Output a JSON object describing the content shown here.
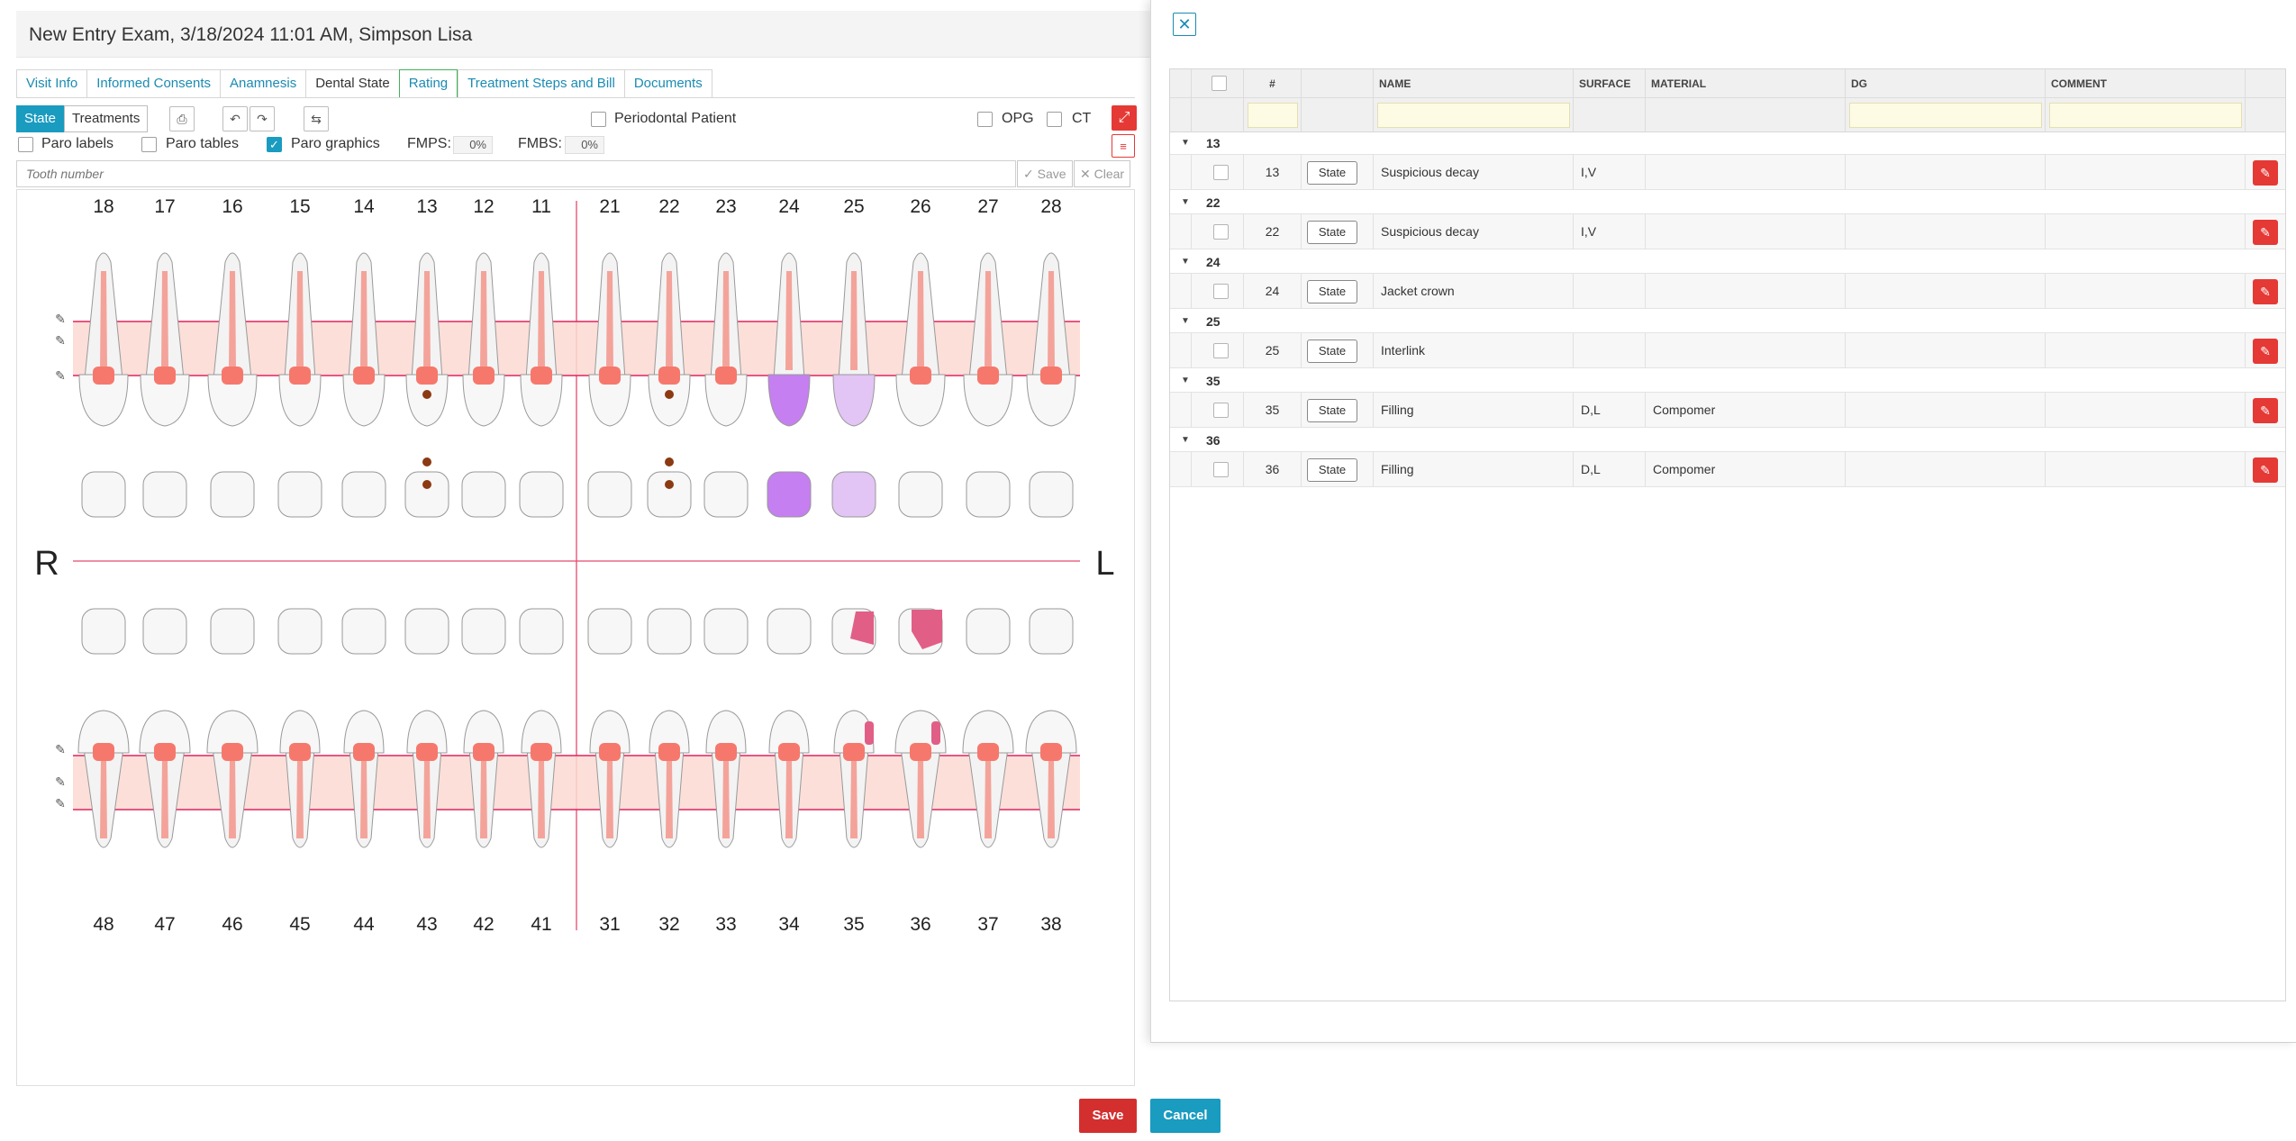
{
  "exam": {
    "title": "New Entry Exam, 3/18/2024 11:01 AM, Simpson Lisa",
    "tabs": [
      {
        "label": "Visit Info"
      },
      {
        "label": "Informed Consents"
      },
      {
        "label": "Anamnesis"
      },
      {
        "label": "Dental State"
      },
      {
        "label": "Rating"
      },
      {
        "label": "Treatment Steps and Bill"
      },
      {
        "label": "Documents"
      }
    ],
    "active_tab": "Dental State",
    "toolbar": {
      "state_label": "State",
      "treatments_label": "Treatments",
      "print_icon": "printer-icon",
      "undo_icon": "undo-icon",
      "redo_icon": "redo-icon",
      "swap_icon": "swap-icon",
      "periodontal_label": "Periodontal Patient",
      "opg_label": "OPG",
      "ct_label": "CT"
    },
    "options": {
      "paro_labels": "Paro labels",
      "paro_tables": "Paro tables",
      "paro_graphics": "Paro graphics",
      "paro_graphics_checked": true,
      "fmps_label": "FMPS:",
      "fmps_value": "0%",
      "fmbs_label": "FMBS:",
      "fmbs_value": "0%"
    },
    "tooth_input_placeholder": "Tooth number",
    "save_small": "Save",
    "clear_small": "Clear",
    "chart": {
      "upper_numbers": [
        "18",
        "17",
        "16",
        "15",
        "14",
        "13",
        "12",
        "11",
        "21",
        "22",
        "23",
        "24",
        "25",
        "26",
        "27",
        "28"
      ],
      "lower_numbers": [
        "48",
        "47",
        "46",
        "45",
        "44",
        "43",
        "42",
        "41",
        "31",
        "32",
        "33",
        "34",
        "35",
        "36",
        "37",
        "38"
      ],
      "side_right": "R",
      "side_left": "L"
    },
    "save_button": "Save",
    "cancel_button": "Cancel"
  },
  "panel": {
    "close_icon": "close-icon",
    "columns": {
      "num": "#",
      "name": "NAME",
      "surface": "SURFACE",
      "material": "MATERIAL",
      "dg": "DG",
      "comment": "COMMENT"
    },
    "groups": [
      {
        "group": "13",
        "row": {
          "num": "13",
          "state": "State",
          "name": "Suspicious decay",
          "surface": "I,V",
          "material": "",
          "dg": "",
          "comment": ""
        }
      },
      {
        "group": "22",
        "row": {
          "num": "22",
          "state": "State",
          "name": "Suspicious decay",
          "surface": "I,V",
          "material": "",
          "dg": "",
          "comment": ""
        }
      },
      {
        "group": "24",
        "row": {
          "num": "24",
          "state": "State",
          "name": "Jacket crown",
          "surface": "",
          "material": "",
          "dg": "",
          "comment": ""
        }
      },
      {
        "group": "25",
        "row": {
          "num": "25",
          "state": "State",
          "name": "Interlink",
          "surface": "",
          "material": "",
          "dg": "",
          "comment": ""
        }
      },
      {
        "group": "35",
        "row": {
          "num": "35",
          "state": "State",
          "name": "Filling",
          "surface": "D,L",
          "material": "Compomer",
          "dg": "",
          "comment": ""
        }
      },
      {
        "group": "36",
        "row": {
          "num": "36",
          "state": "State",
          "name": "Filling",
          "surface": "D,L",
          "material": "Compomer",
          "dg": "",
          "comment": ""
        }
      }
    ]
  }
}
